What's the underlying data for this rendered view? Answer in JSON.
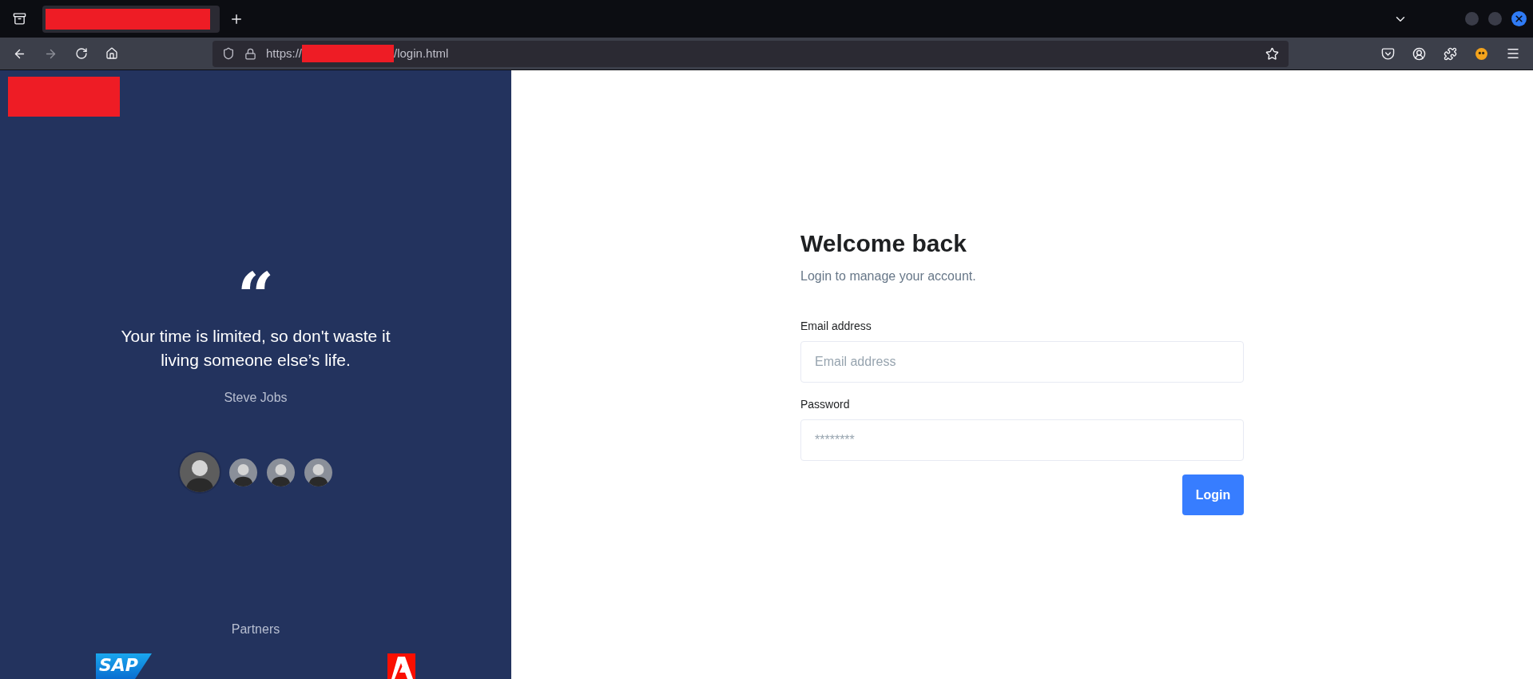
{
  "browser": {
    "tabs": [
      {
        "redacted": true,
        "selected": true
      }
    ],
    "url": {
      "scheme": "https://",
      "redacted": true,
      "path": "/login.html"
    }
  },
  "brand_panel": {
    "logo_redacted": true,
    "quote_mark": "“",
    "quote": "Your time is limited, so don't waste it living someone else’s life.",
    "author": "Steve Jobs",
    "avatars": [
      {
        "selected": true
      },
      {
        "selected": false
      },
      {
        "selected": false
      },
      {
        "selected": false
      }
    ],
    "partners_title": "Partners",
    "partners": [
      {
        "kind": "sap",
        "text": "SAP"
      },
      {
        "kind": "adobe"
      }
    ]
  },
  "login": {
    "title": "Welcome back",
    "subtitle": "Login to manage your account.",
    "fields": [
      {
        "label": "Email address",
        "placeholder": "Email address"
      },
      {
        "label": "Password",
        "placeholder": "********"
      }
    ],
    "button": "Login"
  }
}
